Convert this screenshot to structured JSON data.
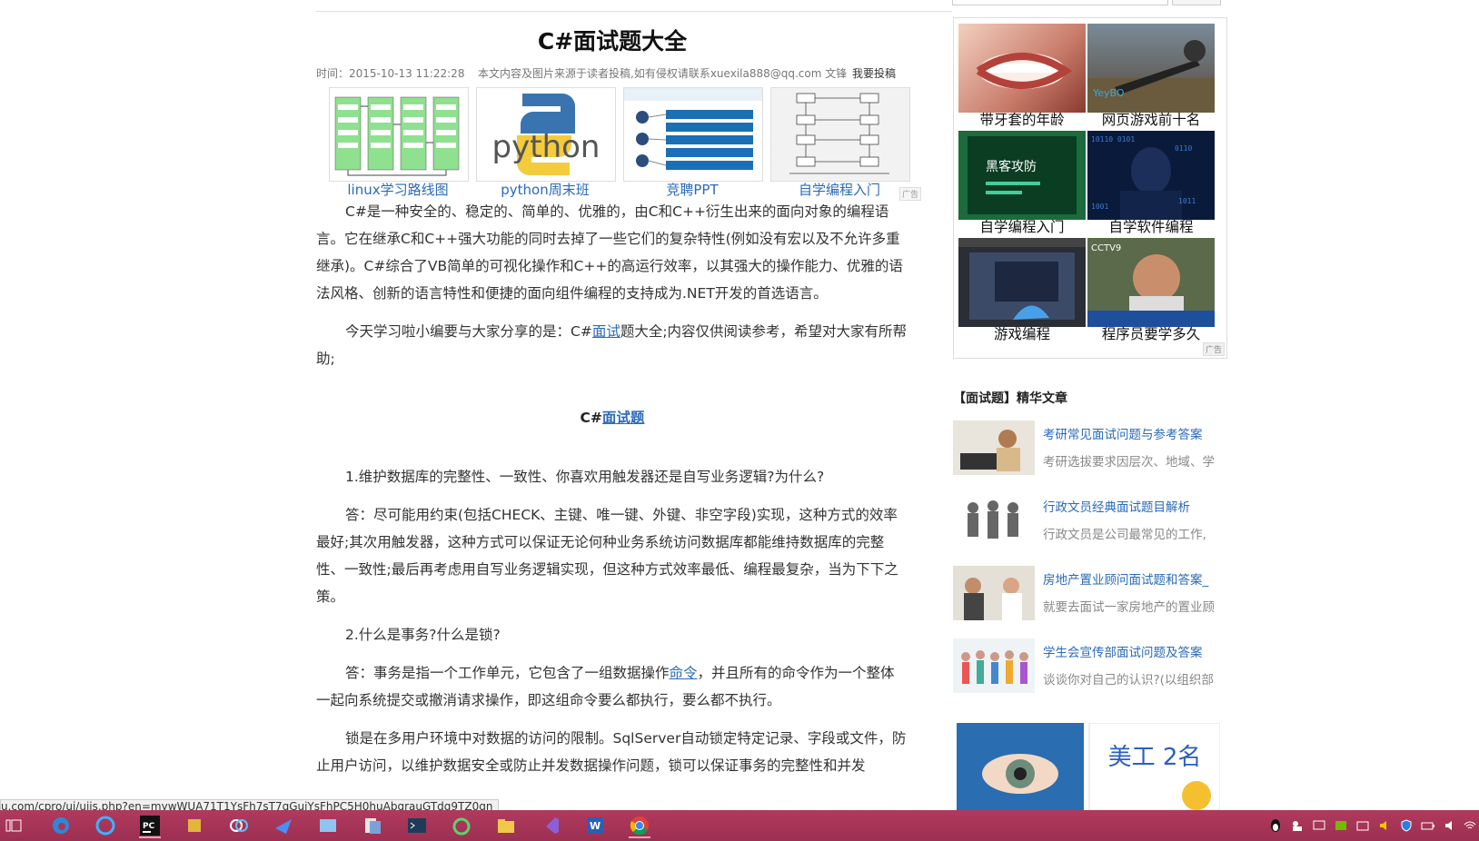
{
  "article": {
    "title": "C#面试题大全",
    "time": "时间：2015-10-13 11:22:28",
    "source": "本文内容及图片来源于读者投稿,如有侵权请联系xuexila888@qq.com 文锋",
    "submit": "我要投稿",
    "ads": [
      {
        "caption": "linux学习路线图",
        "icon": "flowchart-thumbnail"
      },
      {
        "caption": "python周末班",
        "icon": "python-logo"
      },
      {
        "caption": "竞聘PPT",
        "icon": "ppt-thumbnail"
      },
      {
        "caption": "自学编程入门",
        "icon": "diagram-thumbnail"
      }
    ],
    "ad_mark": "广告",
    "p1": "C#是一种安全的、稳定的、简单的、优雅的，由C和C++衍生出来的面向对象的编程语言。它在继承C和C++强大功能的同时去掉了一些它们的复杂特性(例如没有宏以及不允许多重继承)。C#综合了VB简单的可视化操作和C++的高运行效率，以其强大的操作能力、优雅的语法风格、创新的语言特性和便捷的面向组件编程的支持成为.NET开发的首选语言。",
    "p2_before": "今天学习啦小编要与大家分享的是：C#",
    "p2_link": "面试",
    "p2_after": "题大全;内容仅供阅读参考，希望对大家有所帮助;",
    "heading_prefix": "C#",
    "heading_link": "面试题",
    "q1": "1.维护数据库的完整性、一致性、你喜欢用触发器还是自写业务逻辑?为什么?",
    "a1": "答：尽可能用约束(包括CHECK、主键、唯一键、外键、非空字段)实现，这种方式的效率最好;其次用触发器，这种方式可以保证无论何种业务系统访问数据库都能维持数据库的完整性、一致性;最后再考虑用自写业务逻辑实现，但这种方式效率最低、编程最复杂，当为下下之策。",
    "q2": "2.什么是事务?什么是锁?",
    "a2_before": "答：事务是指一个工作单元，它包含了一组数据操作",
    "a2_link": "命令",
    "a2_after": "，并且所有的命令作为一个整体一起向系统提交或撤消请求操作，即这组命令要么都执行，要么都不执行。",
    "p_lock": "锁是在多用户环境中对数据的访问的限制。SqlServer自动锁定特定记录、字段或文件，防止用户访问，以维护数据安全或防止并发数据操作问题，锁可以保证事务的完整性和并发"
  },
  "sidebar": {
    "ads": [
      {
        "caption": "带牙套的年龄"
      },
      {
        "caption": "网页游戏前十名"
      },
      {
        "caption": "自学编程入门",
        "overlay": "黑客攻防"
      },
      {
        "caption": "自学软件编程"
      },
      {
        "caption": "游戏编程"
      },
      {
        "caption": "程序员要学多久",
        "overlay": "CCTV9"
      }
    ],
    "section_title": "【面试题】精华文章",
    "articles": [
      {
        "title": "考研常见面试问题与参考答案",
        "desc": "考研选拔要求因层次、地域、学"
      },
      {
        "title": "行政文员经典面试题目解析",
        "desc": "行政文员是公司最常见的工作,"
      },
      {
        "title": "房地产置业顾问面试题和答案_",
        "desc": "就要去面试一家房地产的置业顾"
      },
      {
        "title": "学生会宣传部面试问题及答案",
        "desc": "谈谈你对自己的认识?(以组织部"
      }
    ],
    "bottom_ad_text": "美工 2名"
  },
  "status_url": "u.com/cpro/ui/uijs.php?en=mywWUA71T1YsFh7sT7qGujYsFhPC5H0huAbqrauGTdq9TZ0qn",
  "taskbar": {
    "icons": [
      "task-view-icon",
      "edge-icon",
      "browser-icon",
      "pycharm-icon",
      "tools-icon",
      "baidu-netdisk-icon",
      "feishu-icon",
      "settings-app-icon",
      "files-icon",
      "terminal-icon",
      "frog-icon",
      "folder-icon",
      "visual-studio-icon",
      "word-icon",
      "chrome-icon"
    ],
    "tray": [
      "qq-icon",
      "people-icon",
      "monitor-icon",
      "nvidia-icon",
      "keyboard-icon",
      "volume-icon",
      "shield-icon",
      "battery-icon",
      "speaker-icon",
      "wifi-icon"
    ]
  },
  "colors": {
    "link": "#2a6ab8",
    "taskbar": "#a8355a"
  }
}
